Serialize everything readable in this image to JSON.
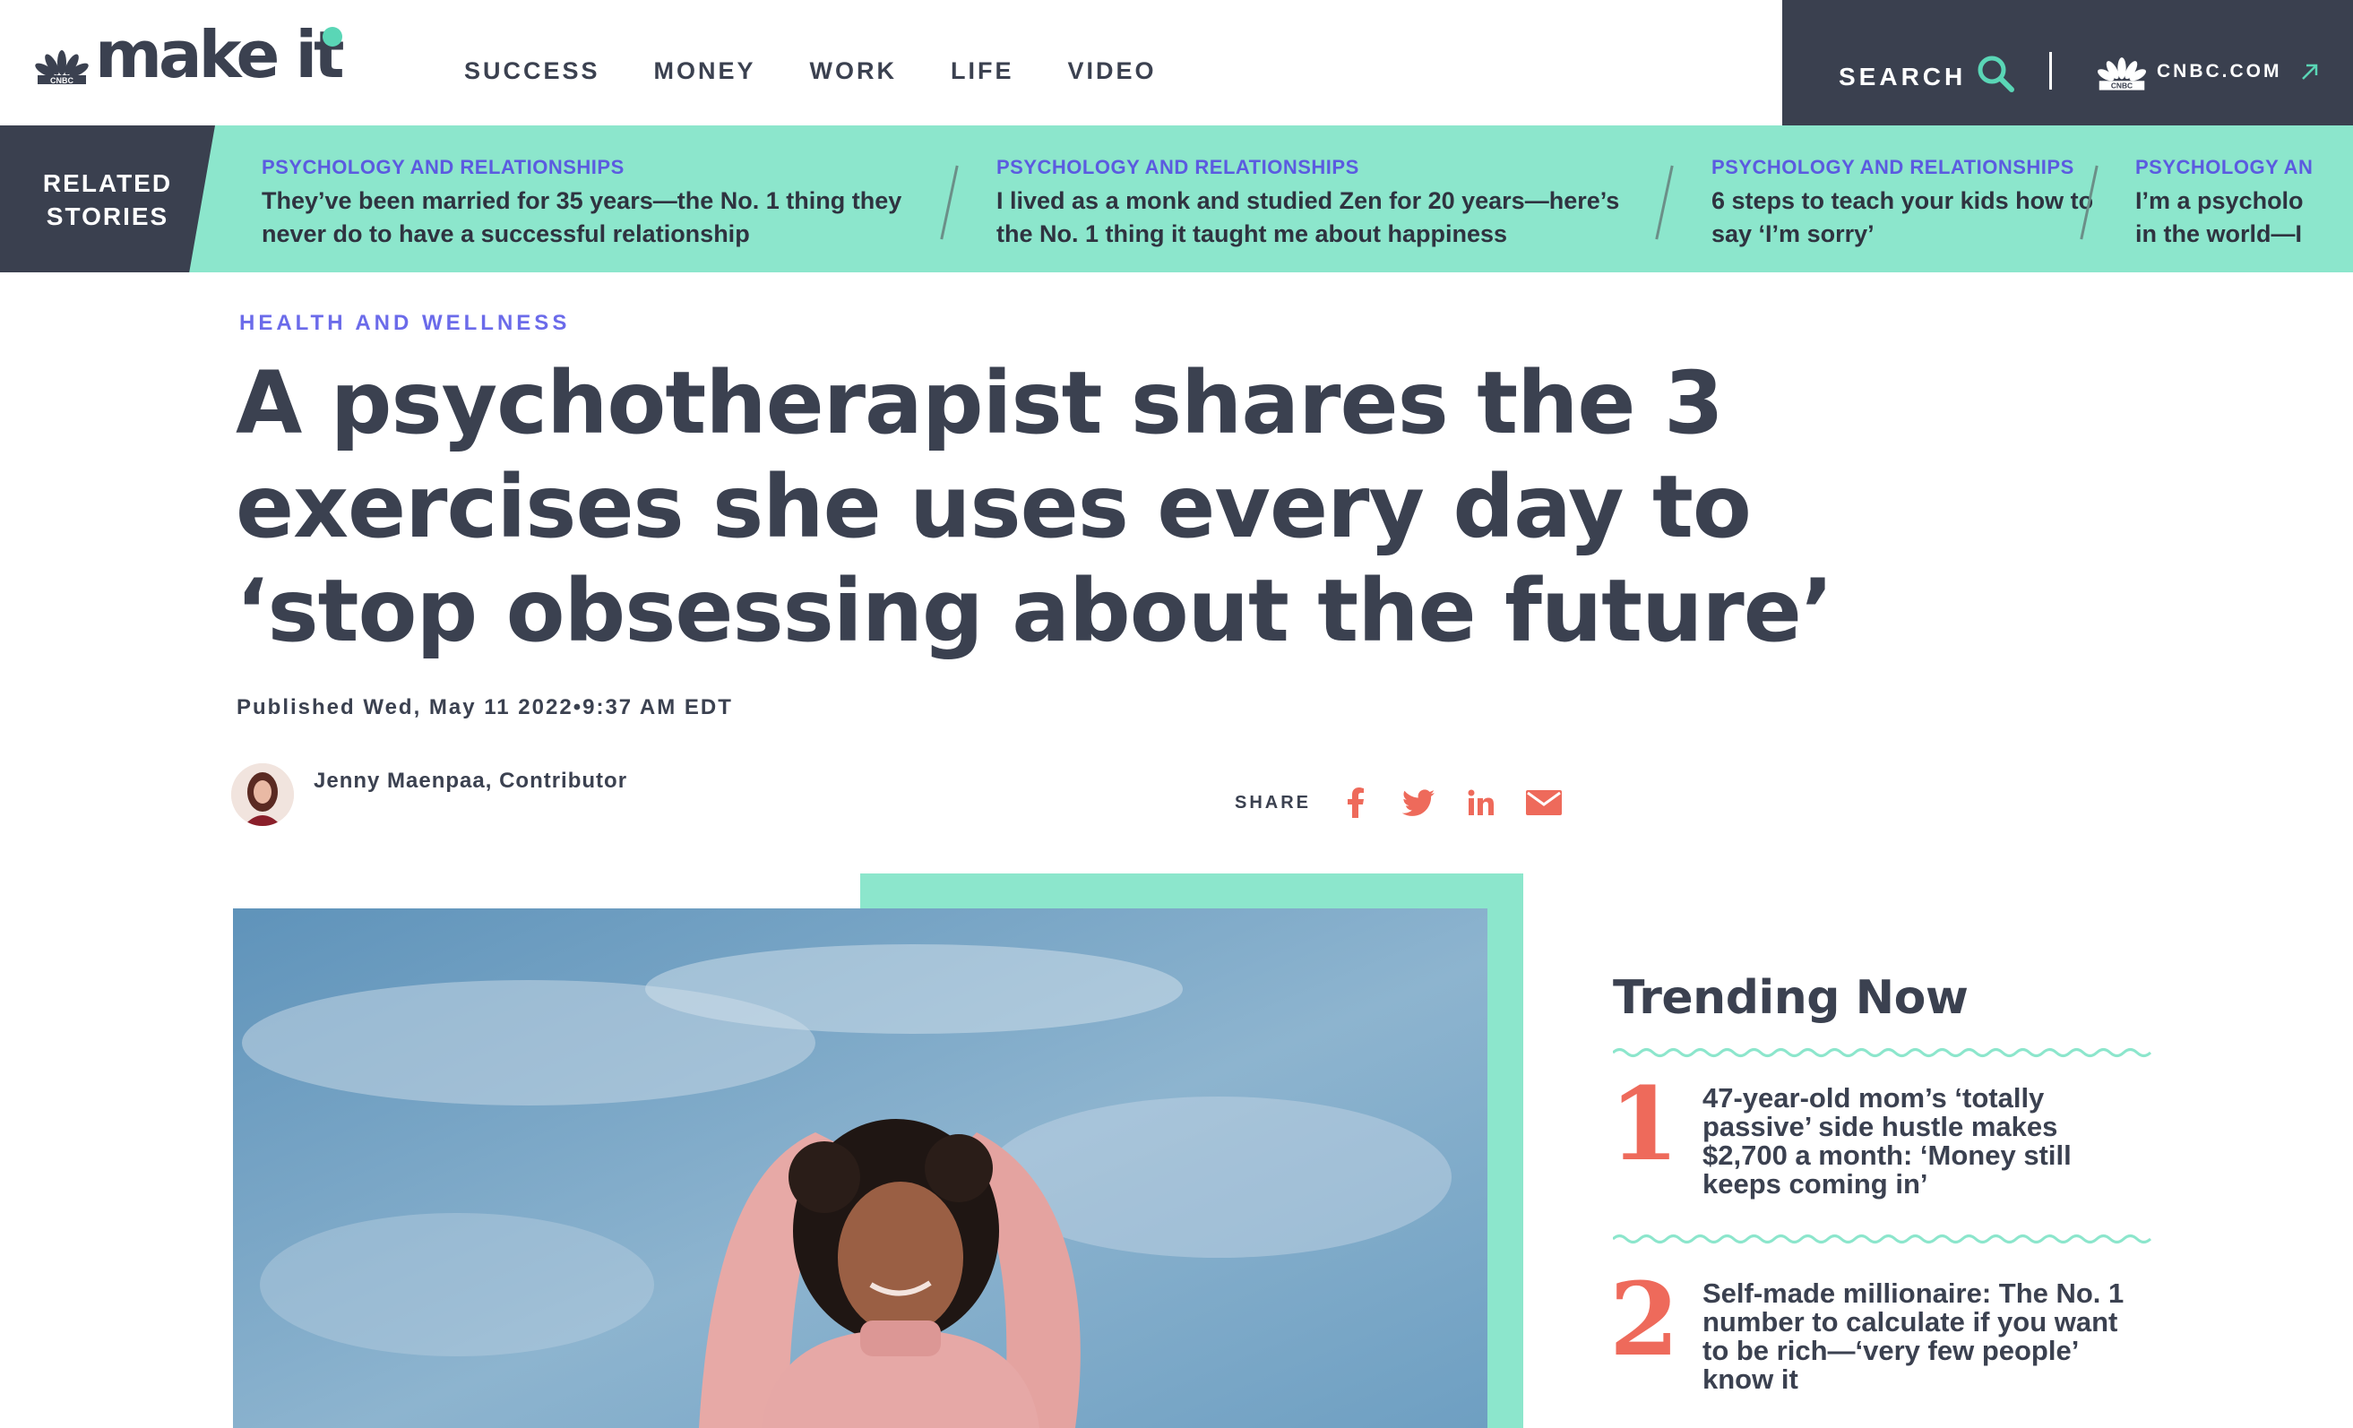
{
  "header": {
    "logo_text": "make it",
    "nav": [
      "SUCCESS",
      "MONEY",
      "WORK",
      "LIFE",
      "VIDEO"
    ],
    "search_label": "SEARCH",
    "cnbc_link": "CNBC.COM"
  },
  "related": {
    "label": "RELATED STORIES",
    "stories": [
      {
        "category": "PSYCHOLOGY AND RELATIONSHIPS",
        "title": "They’ve been married for 35 years—the No. 1 thing they never do to have a successful relationship"
      },
      {
        "category": "PSYCHOLOGY AND RELATIONSHIPS",
        "title": "I lived as a monk and studied Zen for 20 years—here’s the No. 1 thing it taught me about happiness"
      },
      {
        "category": "PSYCHOLOGY AND RELATIONSHIPS",
        "title": "6 steps to teach your kids how to say ‘I’m sorry’"
      },
      {
        "category": "PSYCHOLOGY AN",
        "title": "I’m a psycholo in the world—I"
      }
    ]
  },
  "article": {
    "section": "HEALTH AND WELLNESS",
    "headline": "A psychotherapist shares the 3 exercises she uses every day to ‘stop obsessing about the future’",
    "published": "Published Wed, May 11 2022•9:37 AM EDT",
    "author": "Jenny Maenpaa, Contributor",
    "share_label": "SHARE"
  },
  "trending": {
    "title": "Trending Now",
    "items": [
      {
        "num": "1",
        "text": "47-year-old mom’s ‘totally passive’ side hustle makes $2,700 a month: ‘Money still keeps coming in’"
      },
      {
        "num": "2",
        "text": "Self-made millionaire: The No. 1 number to calculate if you want to be rich—‘very few people’ know it"
      }
    ]
  },
  "colors": {
    "accent_mint": "#8ce6cc",
    "dark_slate": "#3a404f",
    "link_purple": "#5b5be0",
    "share_coral": "#ee6a5b"
  },
  "icons": [
    "cnbc-peacock-icon",
    "search-icon",
    "external-arrow-icon",
    "facebook-icon",
    "twitter-icon",
    "linkedin-icon",
    "email-icon"
  ]
}
